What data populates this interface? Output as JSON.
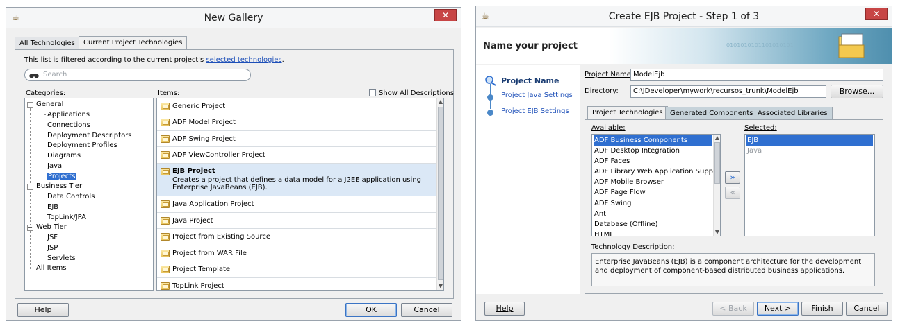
{
  "gallery": {
    "title": "New Gallery",
    "close_glyph": "✕",
    "tabs": [
      "All Technologies",
      "Current Project Technologies"
    ],
    "filter_text": "This list is filtered according to the current project's",
    "filter_link": "selected technologies",
    "filter_end": ".",
    "search_placeholder": "Search",
    "categories_label": "Categories:",
    "items_label": "Items:",
    "show_all_label": "Show All Descriptions",
    "categories": {
      "general": "General",
      "general_children": [
        "Applications",
        "Connections",
        "Deployment Descriptors",
        "Deployment Profiles",
        "Diagrams",
        "Java",
        "Projects"
      ],
      "business_tier": "Business Tier",
      "business_children": [
        "Data Controls",
        "EJB",
        "TopLink/JPA"
      ],
      "web_tier": "Web Tier",
      "web_children": [
        "JSF",
        "JSP",
        "Servlets"
      ],
      "all_items": "All Items"
    },
    "items": [
      "Generic Project",
      "ADF Model Project",
      "ADF Swing Project",
      "ADF ViewController Project",
      "EJB Project",
      "Java Application Project",
      "Java Project",
      "Project from Existing Source",
      "Project from WAR File",
      "Project Template",
      "TopLink Project"
    ],
    "ejb_description": "Creates a project that defines a data model for a J2EE application using Enterprise JavaBeans (EJB).",
    "help": "Help",
    "ok": "OK",
    "cancel": "Cancel"
  },
  "ejb": {
    "title": "Create EJB Project - Step 1 of 3",
    "close_glyph": "✕",
    "banner_title": "Name your project",
    "banner_binary": "0101010101101010101",
    "steps": [
      "Project Name",
      "Project Java Settings",
      "Project EJB Settings"
    ],
    "project_name_label": "Project Name:",
    "project_name_value": "ModelEjb",
    "directory_label": "Directory:",
    "directory_value": "C:\\JDeveloper\\mywork\\recursos_trunk\\ModelEjb",
    "browse": "Browse...",
    "tabs": [
      "Project Technologies",
      "Generated Components",
      "Associated Libraries"
    ],
    "available_label": "Available:",
    "selected_label": "Selected:",
    "available": [
      "ADF Business Components",
      "ADF Desktop Integration",
      "ADF Faces",
      "ADF Library Web Application Support",
      "ADF Mobile Browser",
      "ADF Page Flow",
      "ADF Swing",
      "Ant",
      "Database (Offline)",
      "HTML"
    ],
    "selected": [
      "EJB",
      "Java"
    ],
    "tech_desc_label": "Technology Description:",
    "tech_desc": "Enterprise JavaBeans (EJB) is a component architecture for the development and deployment of component-based distributed business applications.",
    "help": "Help",
    "back": "< Back",
    "next": "Next >",
    "finish": "Finish",
    "cancel": "Cancel",
    "add_glyph": "»",
    "remove_glyph": "«"
  }
}
